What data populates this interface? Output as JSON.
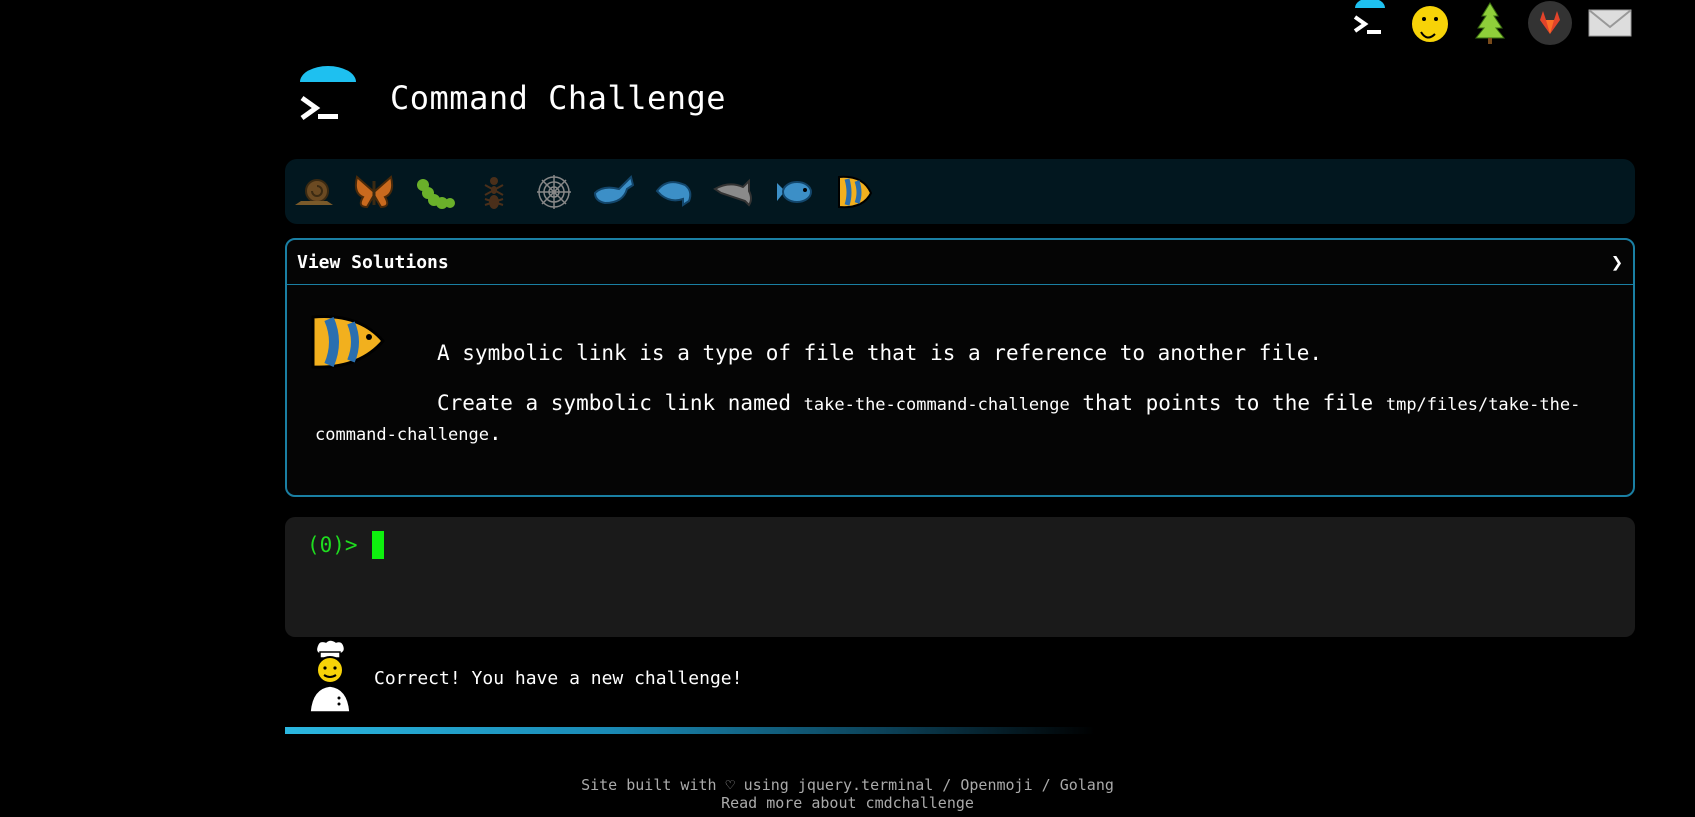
{
  "header": {
    "title": "Command Challenge"
  },
  "top_icons": [
    "terminal-icon",
    "shushing-face-icon",
    "tree-icon",
    "gitlab-icon",
    "envelope-icon"
  ],
  "emoji_strip": [
    "snail-icon",
    "butterfly-icon",
    "caterpillar-icon",
    "ant-icon",
    "spider-web-icon",
    "whale-icon",
    "dolphin-icon",
    "dolphin-gray-icon",
    "fish-icon",
    "tropical-fish-icon"
  ],
  "panel": {
    "label": "View Solutions",
    "chevron": "❯",
    "line1": "A symbolic link is a type of file that is a reference to another file.",
    "line2_a": "Create a symbolic link named ",
    "line2_code1": "take-the-command-challenge",
    "line2_b": " that points to the file ",
    "line2_code2": "tmp/files/take-the-command-challenge",
    "line2_c": "."
  },
  "terminal": {
    "prompt": "(0)>"
  },
  "message": {
    "text": "Correct! You have a new challenge!"
  },
  "progress": {
    "value": 0.6
  },
  "footer": {
    "line1": "Site built with ♡ using jquery.terminal / Openmoji / Golang",
    "line2": "Read more about cmdchallenge"
  },
  "colors": {
    "accent": "#1a7fa3",
    "prompt": "#1fdc1f",
    "cursor": "#0ef00e",
    "strip_bg": "#02171f"
  }
}
